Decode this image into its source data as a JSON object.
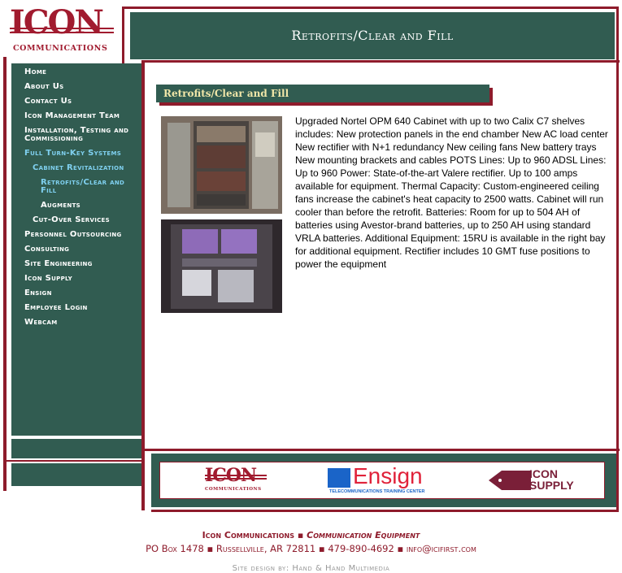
{
  "logo": {
    "word": "ICON",
    "subtitle": "COMMUNICATIONS"
  },
  "header": {
    "title": "Retrofits/Clear and Fill"
  },
  "nav": [
    {
      "label": "Home"
    },
    {
      "label": "About Us"
    },
    {
      "label": "Contact Us"
    },
    {
      "label": "Icon Management Team"
    },
    {
      "label": "Installation, Testing and Commissioning"
    },
    {
      "label": "Full Turn-Key Systems"
    },
    {
      "label": "Cabinet Revitalization"
    },
    {
      "label": "Retrofits/Clear and Fill"
    },
    {
      "label": "Augments"
    },
    {
      "label": "Cut-Over Services"
    },
    {
      "label": "Personnel Outsourcing"
    },
    {
      "label": "Consulting"
    },
    {
      "label": "Site Engineering"
    },
    {
      "label": "Icon Supply"
    },
    {
      "label": "Ensign"
    },
    {
      "label": "Employee Login"
    },
    {
      "label": "Webcam"
    }
  ],
  "content": {
    "heading": "Retrofits/Clear and Fill",
    "body": "Upgraded Nortel OPM 640 Cabinet with up to two Calix C7 shelves includes: New protection panels in the end chamber New AC load center New rectifier with N+1 redundancy New ceiling fans New battery trays New mounting brackets and cables POTS Lines: Up to 960 ADSL Lines: Up to 960 Power: State-of-the-art Valere rectifier. Up to 100 amps available for equipment. Thermal Capacity: Custom-engineered ceiling fans increase the cabinet's heat capacity to 2500 watts. Cabinet will run cooler than before the retrofit. Batteries: Room for up to 504 AH of batteries using Avestor-brand batteries, up to 250 AH using standard VRLA batteries. Additional Equipment: 15RU is available in the right bay for additional equipment. Rectifier includes 10 GMT fuse positions to power the equipment"
  },
  "partners": {
    "icon": {
      "word": "ICON",
      "sub": "COMMUNICATIONS"
    },
    "ensign": {
      "word": "Ensign",
      "sub": "TELECOMMUNICATIONS TRAINING CENTER"
    },
    "supply": {
      "line1": "ICON",
      "line2": "SUPPLY"
    }
  },
  "footer": {
    "company": "Icon Communications",
    "tagline": "Communication Equipment",
    "address": "PO Box 1478 ▪ Russellville, AR 72811 ▪ 479-890-4692 ▪ info@icifirst.com",
    "credit": "Site design by: Hand & Hand Multimedia"
  },
  "colors": {
    "maroon": "#8e1b2b",
    "green": "#315c51",
    "link_active": "#7fd0ef"
  }
}
